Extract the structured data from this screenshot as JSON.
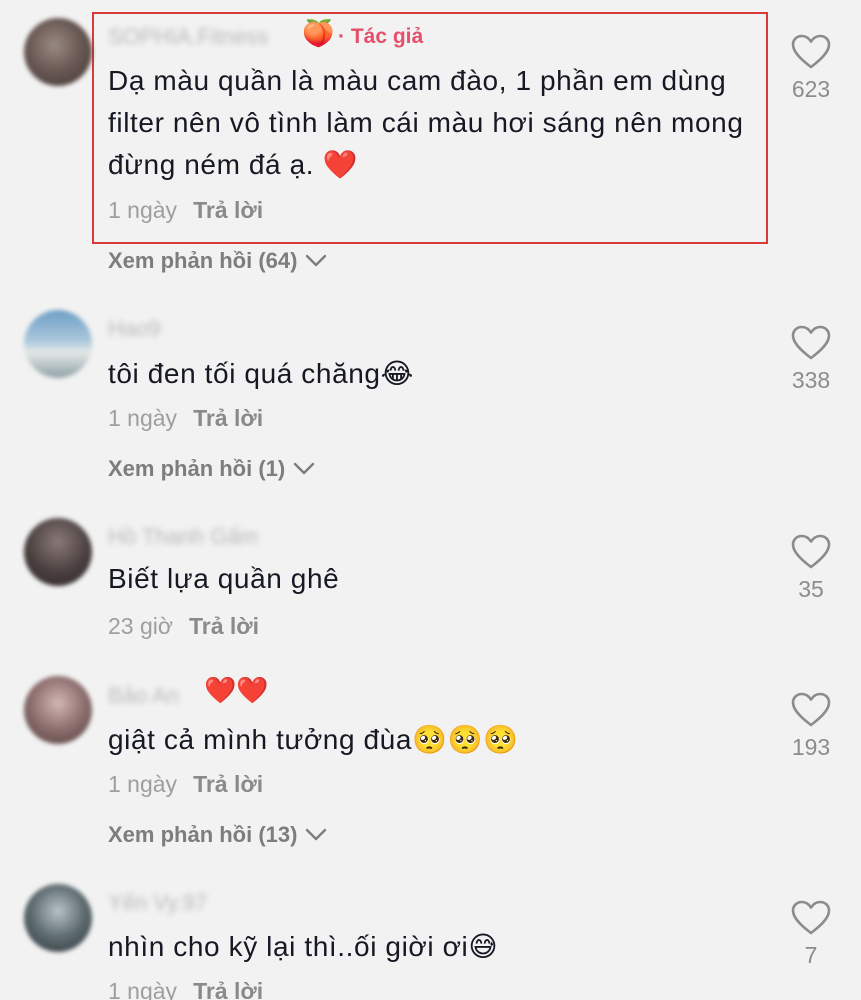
{
  "comments": [
    {
      "username": "SOPHIA.Fitness",
      "name_emoji": "🍑",
      "author_tag": "· Tác giả",
      "text": "Dạ màu quần là màu cam đào, 1 phần em dùng filter nên vô tình làm cái màu hơi sáng nên mong đừng ném đá ạ. ❤️",
      "time": "1 ngày",
      "reply_label": "Trả lời",
      "likes": "623",
      "view_replies": "Xem phản hồi (64)"
    },
    {
      "username": "Hao9",
      "text": "tôi đen tối quá chăng😂",
      "time": "1 ngày",
      "reply_label": "Trả lời",
      "likes": "338",
      "view_replies": "Xem phản hồi (1)"
    },
    {
      "username": "Hồ Thanh Gấm",
      "text": "Biết lựa quần ghê",
      "time": "23 giờ",
      "reply_label": "Trả lời",
      "likes": "35"
    },
    {
      "username": "Bảo An",
      "name_emoji": "❤️❤️",
      "text": "giật cả mình tưởng đùa🥺🥺🥺",
      "time": "1 ngày",
      "reply_label": "Trả lời",
      "likes": "193",
      "view_replies": "Xem phản hồi (13)"
    },
    {
      "username": "Yến Vy.97",
      "text": "nhìn cho kỹ lại thì..ối giời ơi😅",
      "time": "1 ngày",
      "reply_label": "Trả lời",
      "likes": "7"
    }
  ],
  "icons": {
    "like": "heart-outline-icon",
    "expand": "chevron-down-icon"
  },
  "colors": {
    "background": "#f2f2f2",
    "author_tag": "#e64f6b",
    "highlight_border": "#d93a3a"
  }
}
